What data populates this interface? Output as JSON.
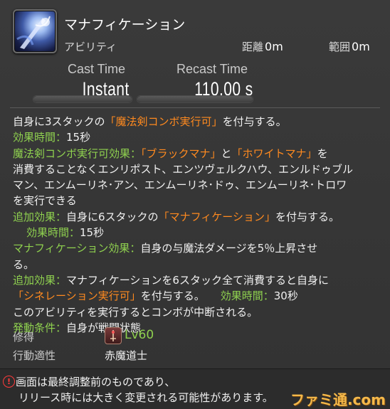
{
  "header": {
    "title": "マナフィケーション",
    "category": "アビリティ",
    "distance_label": "距離",
    "distance_value": "0m",
    "radius_label": "範囲",
    "radius_value": "0m",
    "icon": "sword-magic-icon"
  },
  "cast": {
    "cast_label": "Cast Time",
    "cast_value": "Instant",
    "recast_label": "Recast Time",
    "recast_value": "110.00 s"
  },
  "description": {
    "l1_a": "自身に3スタックの",
    "l1_b": "「魔法剣コンボ実行可」",
    "l1_c": "を付与する。",
    "l2_a": "効果時間：",
    "l2_b": "15秒",
    "l3_a": "魔法剣コンボ実行可効果：",
    "l3_b": "「ブラックマナ」",
    "l3_c": "と",
    "l3_d": "「ホワイトマナ」",
    "l3_e": "を",
    "l4": "消費することなくエンリポスト、エンツヴェルクハウ、エンルドゥブル",
    "l5": "マン、エンムーリネ･アン、エンムーリネ･ドゥ、エンムーリネ･トロワ",
    "l6": "を実行できる",
    "l7_a": "追加効果：",
    "l7_b": "自身に6スタックの",
    "l7_c": "「マナフィケーション」",
    "l7_d": "を付与する。",
    "l8_a": "効果時間：",
    "l8_b": "15秒",
    "l9_a": "マナフィケーション効果：",
    "l9_b": "自身の与魔法ダメージを5％上昇させ",
    "l10": "る。",
    "l11_a": "追加効果：",
    "l11_b": "マナフィケーションを6スタック全て消費すると自身に",
    "l12_a": "「シネレーション実行可」",
    "l12_b": "を付与する。",
    "l12_c": "効果時間：",
    "l12_d": "30秒",
    "l13": "このアビリティを実行するとコンボが中断される。",
    "l14_a": "発動条件：",
    "l14_b": "自身が戦闘状態"
  },
  "acquire": {
    "learn_label": "修得",
    "level": "Lv60",
    "job_icon": "red-mage-icon",
    "class_label": "行動適性",
    "class_value": "赤魔道士"
  },
  "footer": {
    "line1": "画面は最終調整前のものであり、",
    "line2": "リリース時には大きく変更される可能性があります。",
    "watermark": "ファミ通.com"
  },
  "colors": {
    "effect_label": "#8fd14f",
    "status_name": "#ff8a1f",
    "warning": "#ff3b3b",
    "watermark": "#f4b84a"
  }
}
